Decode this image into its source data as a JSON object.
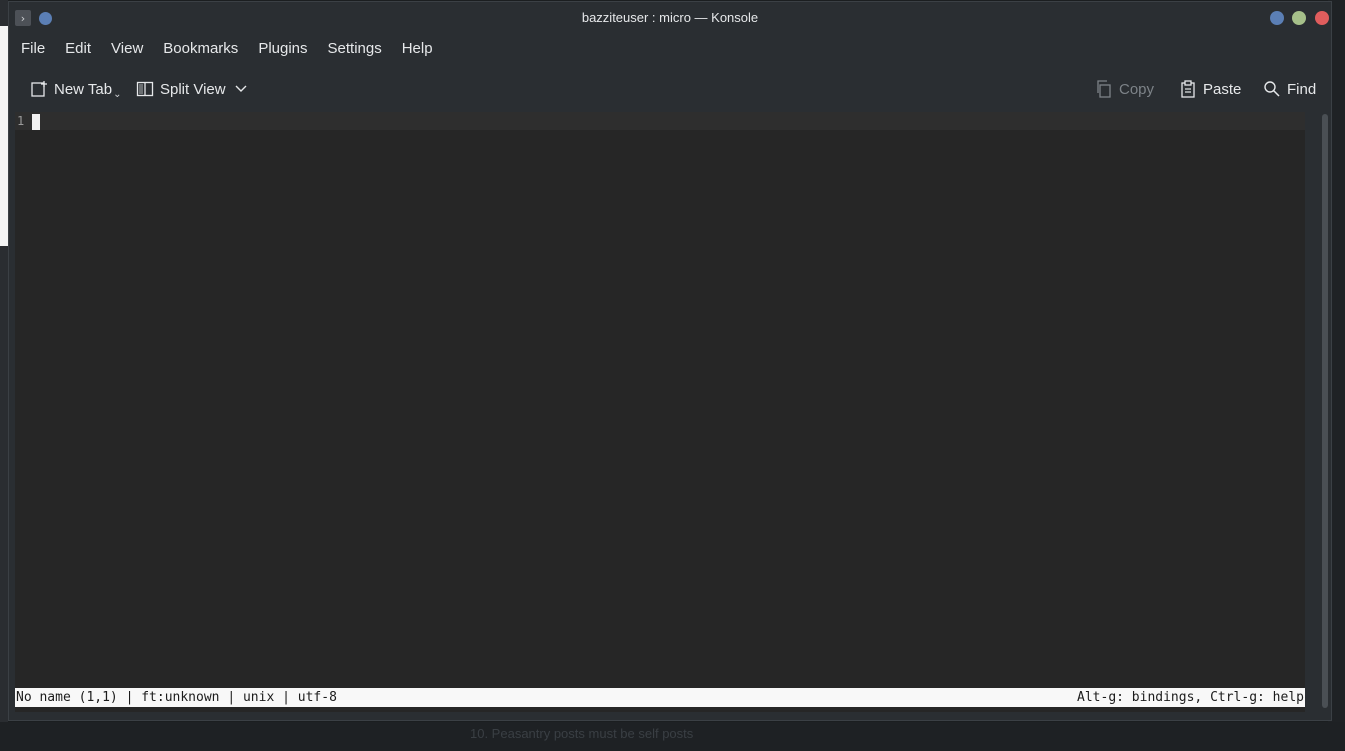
{
  "window": {
    "title": "bazziteuser : micro — Konsole"
  },
  "menubar": {
    "items": [
      "File",
      "Edit",
      "View",
      "Bookmarks",
      "Plugins",
      "Settings",
      "Help"
    ]
  },
  "toolbar": {
    "new_tab": "New Tab",
    "split_view": "Split View",
    "copy": "Copy",
    "paste": "Paste",
    "find": "Find"
  },
  "editor": {
    "line_number": "1",
    "status_left": "No name (1,1) | ft:unknown | unix | utf-8",
    "status_right": "Alt-g: bindings, Ctrl-g: help"
  },
  "background": {
    "bottom_text": "10. Peasantry posts must be self posts"
  },
  "colors": {
    "window_bg": "#2a2e32",
    "terminal_bg": "#262626",
    "statusbar_bg": "#f8f8f8",
    "close": "#e05d5d",
    "maximize": "#a6c08a",
    "minimize": "#5b7fb5"
  }
}
